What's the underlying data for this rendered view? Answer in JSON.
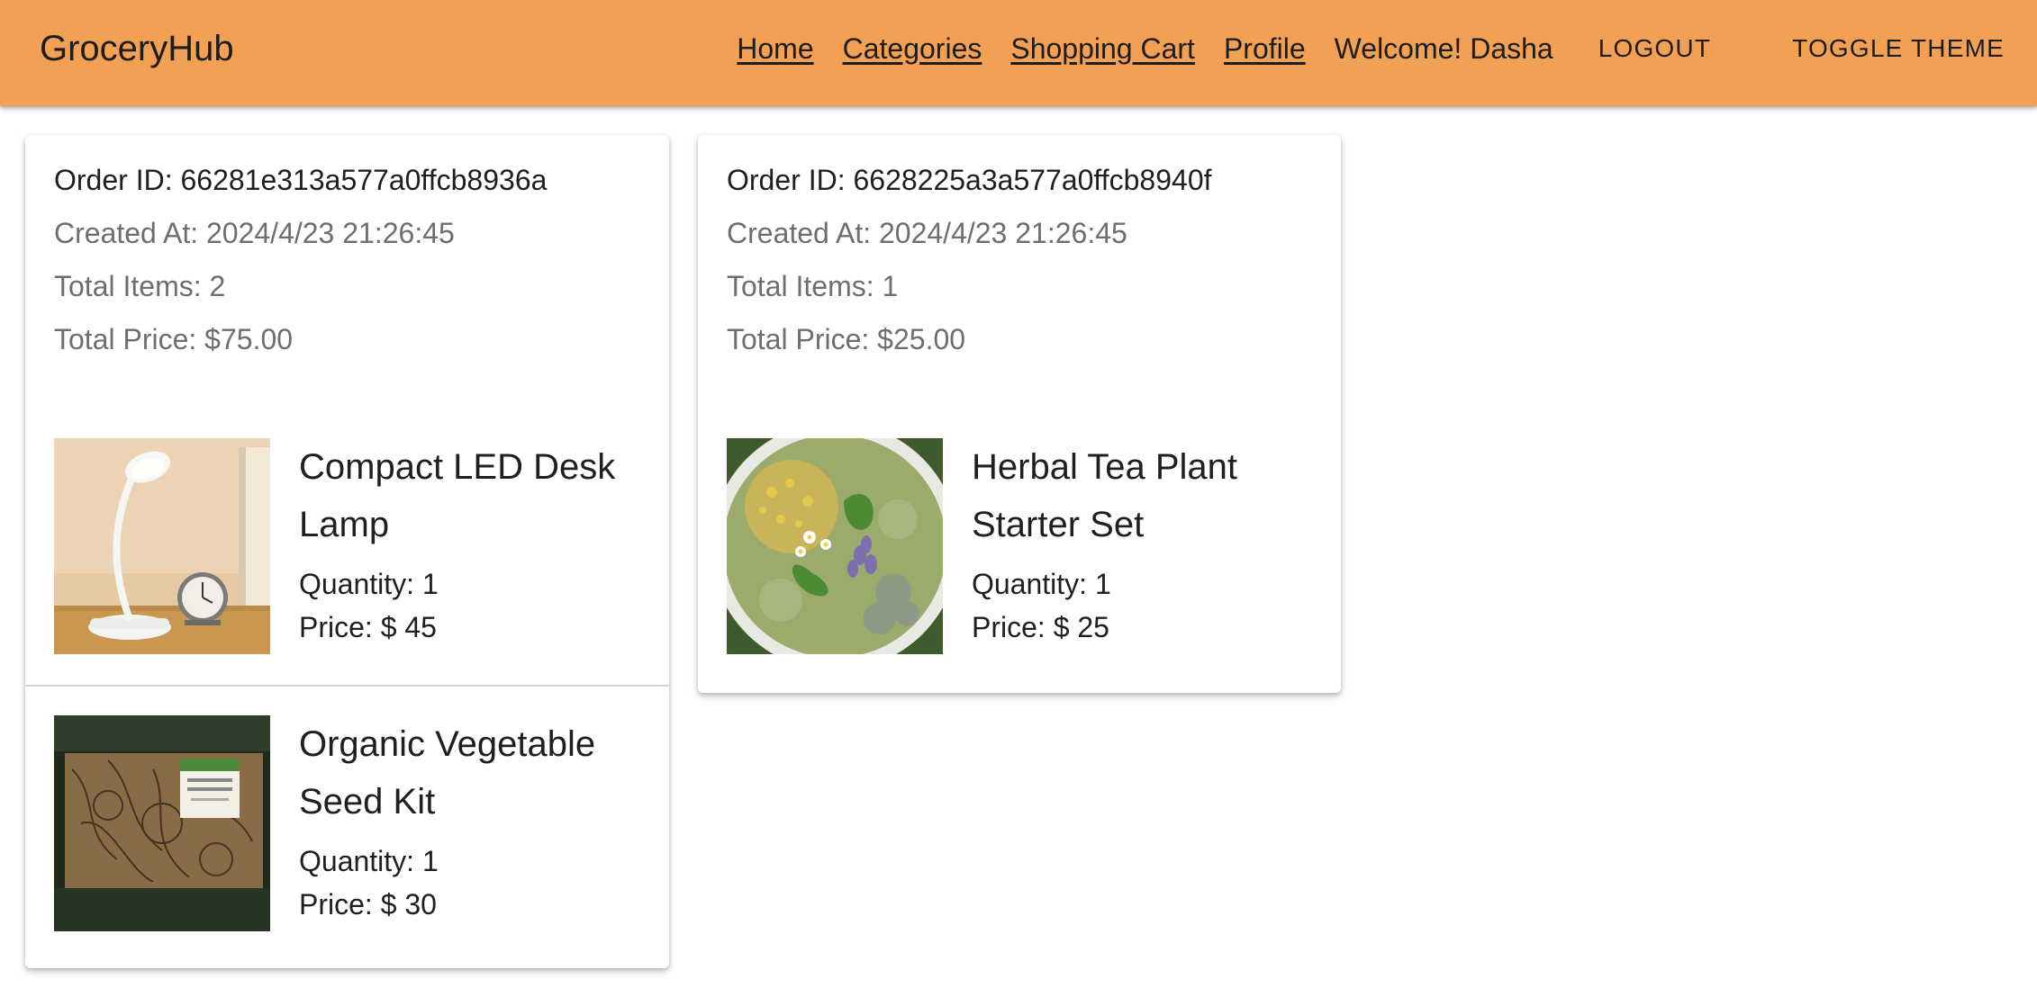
{
  "header": {
    "brand": "GroceryHub",
    "nav": {
      "home": "Home",
      "categories": "Categories",
      "cart": "Shopping Cart",
      "profile": "Profile"
    },
    "welcome": "Welcome! Dasha",
    "logout": "LOGOUT",
    "toggle_theme": "TOGGLE THEME",
    "accent_color": "#f2a054"
  },
  "orders": [
    {
      "id_label": "Order ID: 66281e313a577a0ffcb8936a",
      "created_label": "Created At: 2024/4/23 21:26:45",
      "items_label": "Total Items: 2",
      "price_label": "Total Price: $75.00",
      "items": [
        {
          "name": "Compact LED Desk Lamp",
          "quantity": "Quantity: 1",
          "price": "Price: $ 45",
          "image": "desk-lamp-photo"
        },
        {
          "name": "Organic Vegetable Seed Kit",
          "quantity": "Quantity: 1",
          "price": "Price: $ 30",
          "image": "seed-kit-photo"
        }
      ]
    },
    {
      "id_label": "Order ID: 6628225a3a577a0ffcb8940f",
      "created_label": "Created At: 2024/4/23 21:26:45",
      "items_label": "Total Items: 1",
      "price_label": "Total Price: $25.00",
      "items": [
        {
          "name": "Herbal Tea Plant Starter Set",
          "quantity": "Quantity: 1",
          "price": "Price: $ 25",
          "image": "herbal-tea-photo"
        }
      ]
    }
  ]
}
